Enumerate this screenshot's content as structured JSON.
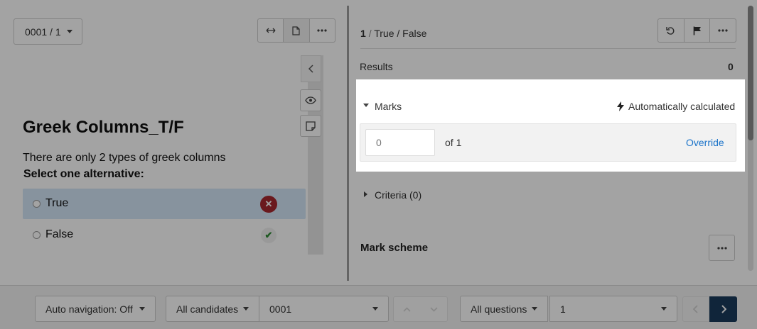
{
  "left_pane": {
    "page_selector": "0001 / 1",
    "tool_icons": [
      "expand-horizontal-icon",
      "document-icon",
      "more-icon"
    ]
  },
  "question": {
    "title": "Greek Columns_T/F",
    "text": "There are only 2 types of greek columns",
    "instruction": "Select one alternative:",
    "options": [
      {
        "label": "True",
        "selected": true,
        "result": "incorrect"
      },
      {
        "label": "False",
        "selected": false,
        "result": "correct"
      }
    ]
  },
  "right_pane": {
    "header_number": "1",
    "header_sep": "/",
    "header_type": "True / False",
    "tool_icons": [
      "undo-icon",
      "flag-icon",
      "more-icon"
    ],
    "results_label": "Results",
    "results_value": "0",
    "marks": {
      "label": "Marks",
      "auto_label": "Automatically calculated",
      "input_placeholder": "0",
      "of_label": "of 1",
      "override_label": "Override"
    },
    "criteria_label": "Criteria (0)",
    "mark_scheme_label": "Mark scheme"
  },
  "bottom_bar": {
    "auto_navigation": "Auto navigation: Off",
    "all_candidates": "All candidates",
    "candidate_id": "0001",
    "all_questions": "All questions",
    "question_id": "1"
  },
  "colors": {
    "accent_link": "#1a73c9",
    "next_button": "#1a3b5c",
    "incorrect": "#a62830",
    "correct": "#2e8b34",
    "selected_option": "#d4e6f8"
  }
}
